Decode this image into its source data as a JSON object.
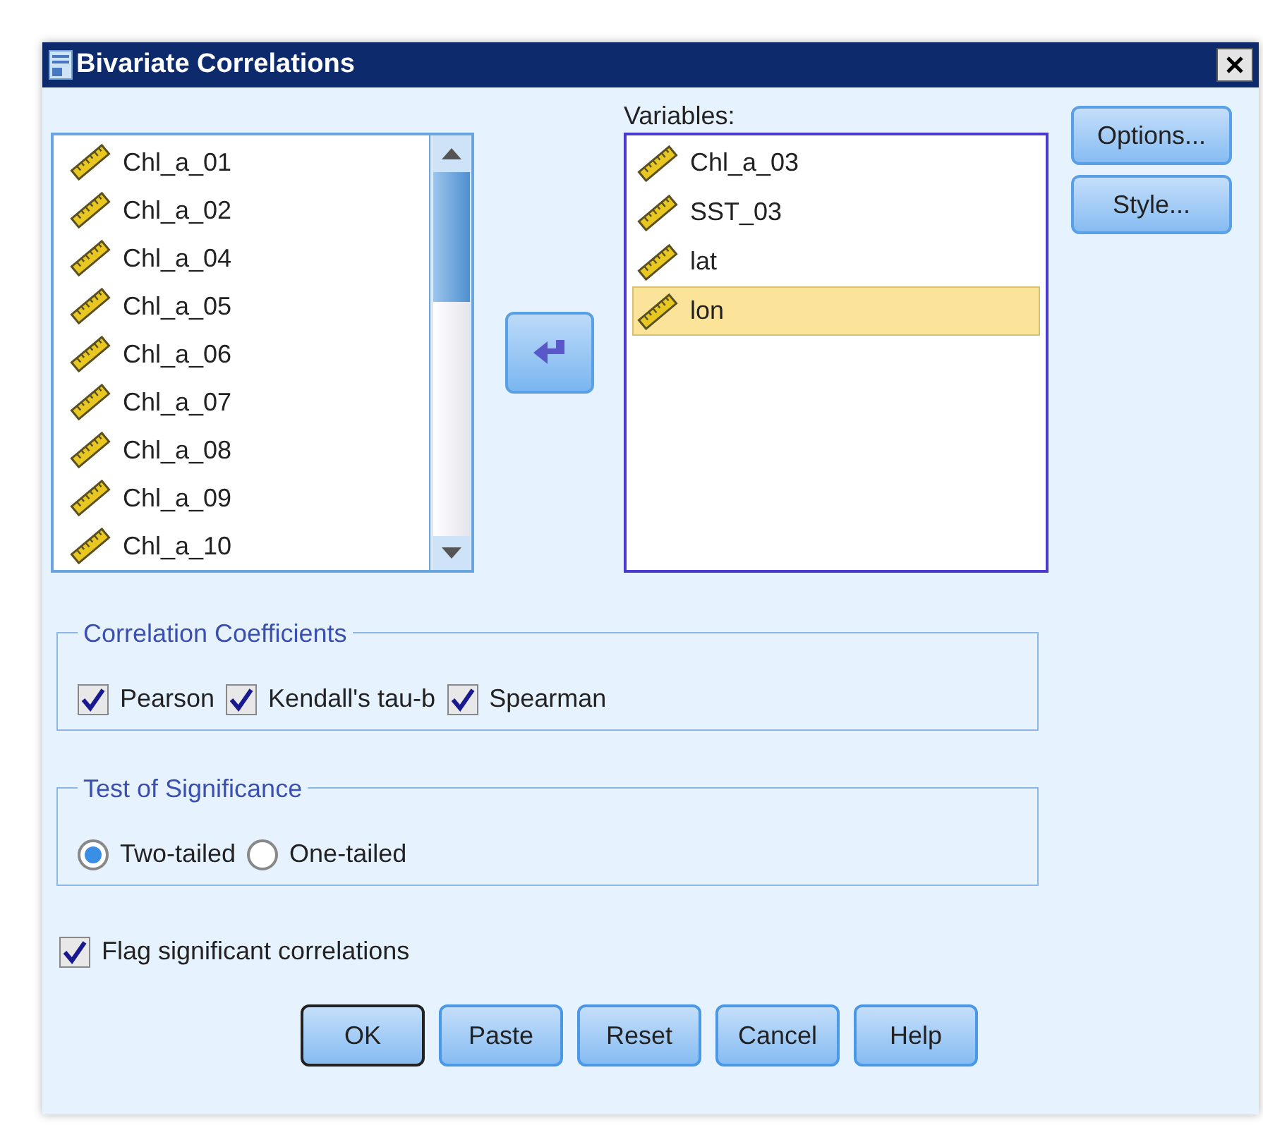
{
  "window": {
    "title": "Bivariate Correlations"
  },
  "source_list": {
    "items": [
      {
        "label": "Chl_a_01",
        "selected": false
      },
      {
        "label": "Chl_a_02",
        "selected": false
      },
      {
        "label": "Chl_a_04",
        "selected": false
      },
      {
        "label": "Chl_a_05",
        "selected": false
      },
      {
        "label": "Chl_a_06",
        "selected": false
      },
      {
        "label": "Chl_a_07",
        "selected": false
      },
      {
        "label": "Chl_a_08",
        "selected": false
      },
      {
        "label": "Chl_a_09",
        "selected": false
      },
      {
        "label": "Chl_a_10",
        "selected": false
      }
    ]
  },
  "variables": {
    "label": "Variables:",
    "items": [
      {
        "label": "Chl_a_03",
        "selected": false
      },
      {
        "label": "SST_03",
        "selected": false
      },
      {
        "label": "lat",
        "selected": false
      },
      {
        "label": "lon",
        "selected": true
      }
    ]
  },
  "side_buttons": [
    "Options...",
    "Style..."
  ],
  "correlation_coefficients": {
    "title": "Correlation Coefficients",
    "options": [
      {
        "label": "Pearson",
        "checked": true
      },
      {
        "label": "Kendall's tau-b",
        "checked": true
      },
      {
        "label": "Spearman",
        "checked": true
      }
    ]
  },
  "test_of_significance": {
    "title": "Test of Significance",
    "options": [
      {
        "label": "Two-tailed",
        "selected": true
      },
      {
        "label": "One-tailed",
        "selected": false
      }
    ]
  },
  "flag_significant": {
    "label": "Flag significant correlations",
    "checked": true
  },
  "buttons": [
    {
      "label": "OK",
      "default": true
    },
    {
      "label": "Paste",
      "default": false
    },
    {
      "label": "Reset",
      "default": false
    },
    {
      "label": "Cancel",
      "default": false
    },
    {
      "label": "Help",
      "default": false
    }
  ]
}
